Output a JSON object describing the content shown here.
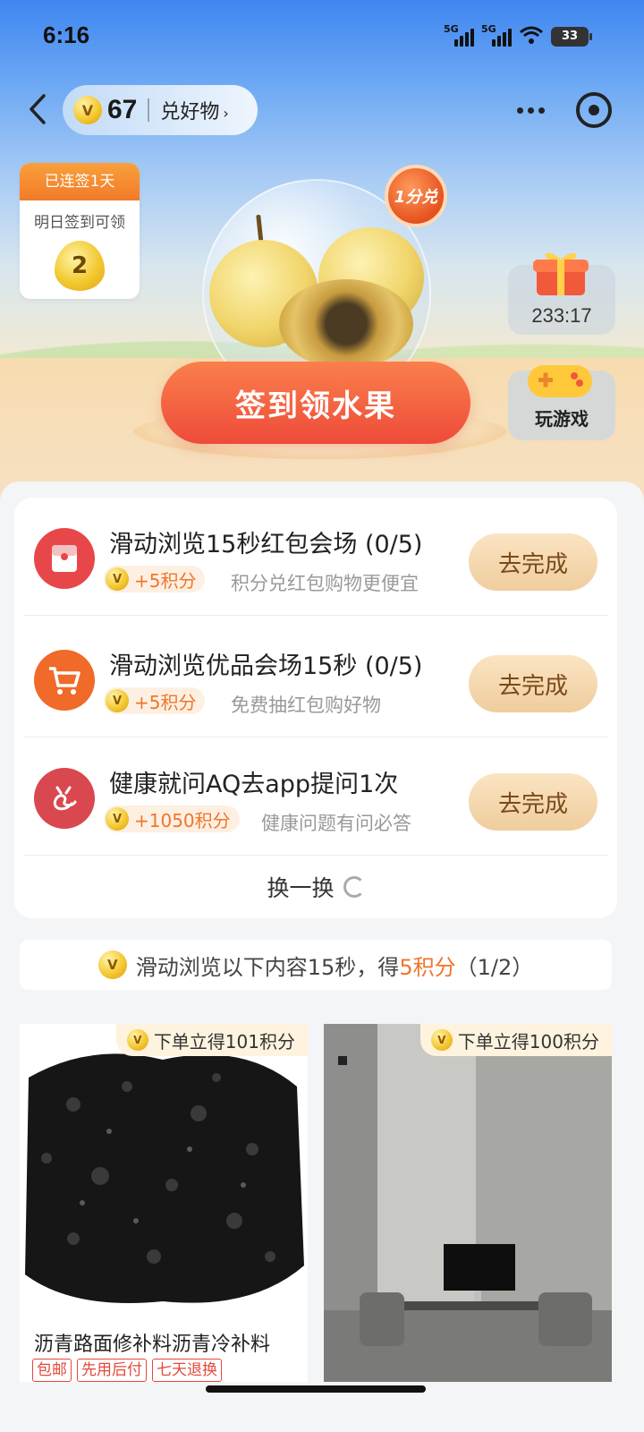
{
  "status_bar": {
    "time": "6:16",
    "network_1": "5G",
    "network_2": "5G",
    "battery": "33"
  },
  "header": {
    "points": "67",
    "exchange_label": "兑好物",
    "exchange_chevron": "›"
  },
  "streak": {
    "title": "已连签1天",
    "subtitle": "明日签到可领",
    "reward": "2"
  },
  "hero": {
    "badge": "1分兑",
    "checkin_label": "签到领水果"
  },
  "gift": {
    "timer": "233:17"
  },
  "game": {
    "label": "玩游戏"
  },
  "tasks": [
    {
      "title": "滑动浏览15秒红包会场 (0/5)",
      "reward": "+5积分",
      "desc": "积分兑红包购物更便宜",
      "button": "去完成",
      "icon": "red-envelope-icon",
      "icon_color": "#e8474a"
    },
    {
      "title": "滑动浏览优品会场15秒 (0/5)",
      "reward": "+5积分",
      "desc": "免费抽红包购好物",
      "button": "去完成",
      "icon": "cart-icon",
      "icon_color": "#f06a2a"
    },
    {
      "title": "健康就问AQ去app提问1次",
      "reward": "+1050积分",
      "desc": "健康问题有问必答",
      "button": "去完成",
      "icon": "health-app-icon",
      "icon_color": "#d9484e"
    }
  ],
  "refresh_label": "换一换",
  "browse": {
    "prefix": "滑动浏览以下内容15秒，得",
    "points": "5积分",
    "progress": "（1/2）"
  },
  "products": [
    {
      "tag": "下单立得101积分",
      "title": "沥青路面修补料沥青冷补料",
      "badges": [
        "包邮",
        "先用后付",
        "七天退换"
      ]
    },
    {
      "tag": "下单立得100积分"
    }
  ],
  "colors": {
    "accent": "#f0752b",
    "checkin_button": "#ee4b39",
    "task_button": "#efcd9d"
  }
}
